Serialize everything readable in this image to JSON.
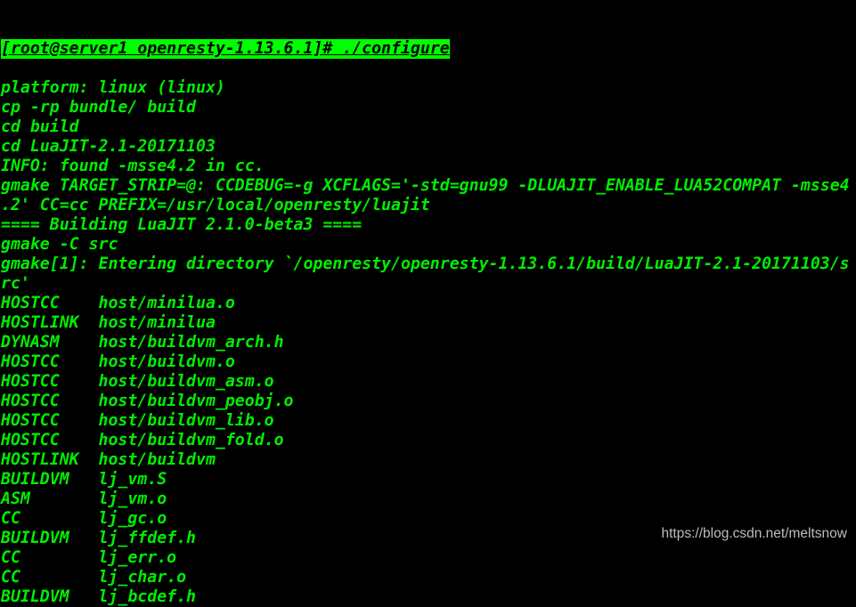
{
  "terminal": {
    "prompt_line": "[root@server1 openresty-1.13.6.1]# ./configure",
    "lines": [
      "platform: linux (linux)",
      "cp -rp bundle/ build",
      "cd build",
      "cd LuaJIT-2.1-20171103",
      "INFO: found -msse4.2 in cc.",
      "gmake TARGET_STRIP=@: CCDEBUG=-g XCFLAGS='-std=gnu99 -DLUAJIT_ENABLE_LUA52COMPAT -msse4",
      ".2' CC=cc PREFIX=/usr/local/openresty/luajit",
      "==== Building LuaJIT 2.1.0-beta3 ====",
      "gmake -C src",
      "gmake[1]: Entering directory `/openresty/openresty-1.13.6.1/build/LuaJIT-2.1-20171103/s",
      "rc'",
      "HOSTCC    host/minilua.o",
      "HOSTLINK  host/minilua",
      "DYNASM    host/buildvm_arch.h",
      "HOSTCC    host/buildvm.o",
      "HOSTCC    host/buildvm_asm.o",
      "HOSTCC    host/buildvm_peobj.o",
      "HOSTCC    host/buildvm_lib.o",
      "HOSTCC    host/buildvm_fold.o",
      "HOSTLINK  host/buildvm",
      "BUILDVM   lj_vm.S",
      "ASM       lj_vm.o",
      "CC        lj_gc.o",
      "BUILDVM   lj_ffdef.h",
      "CC        lj_err.o",
      "CC        lj_char.o",
      "BUILDVM   lj_bcdef.h"
    ],
    "colors": {
      "text": "#00ee00",
      "highlight": "#00ff00",
      "background": "#000000"
    }
  },
  "watermark": "https://blog.csdn.net/meltsnow"
}
